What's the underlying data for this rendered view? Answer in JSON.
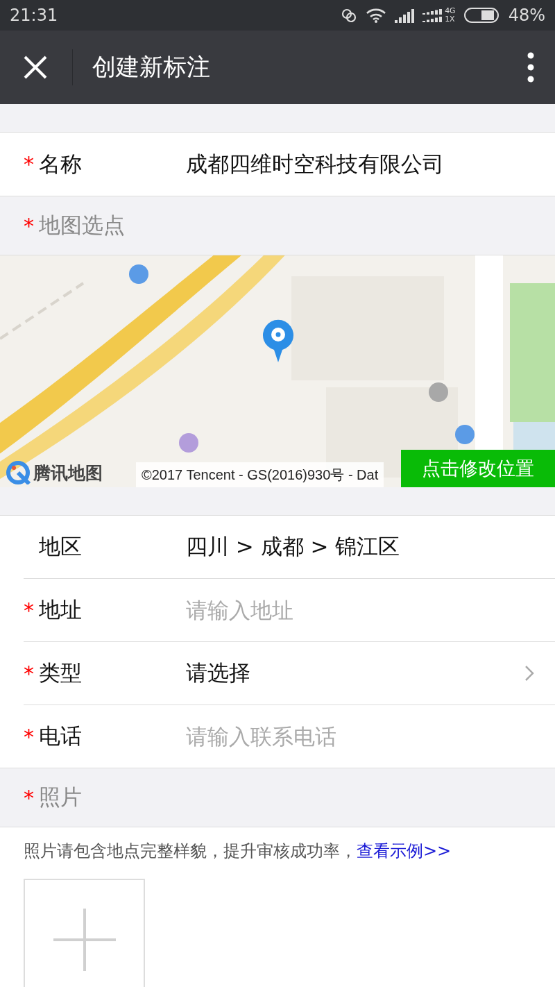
{
  "status_bar": {
    "time": "21:31",
    "network_top": "4G",
    "network_bottom": "1X",
    "battery": "48%"
  },
  "nav": {
    "title": "创建新标注"
  },
  "name_row": {
    "marker": "*",
    "label": "名称",
    "value": "成都四维时空科技有限公司"
  },
  "map_section": {
    "marker": "*",
    "label": "地图选点"
  },
  "map": {
    "logo": "腾讯地图",
    "copyright": "©2017 Tencent - GS(2016)930号 - Dat",
    "button": "点击修改位置"
  },
  "rows": [
    {
      "kind": "value",
      "label": "地区",
      "value": "四川 > 成都 > 锦江区"
    },
    {
      "kind": "input",
      "marker": "*",
      "label": "地址",
      "placeholder": "请输入地址"
    },
    {
      "kind": "select",
      "marker": "*",
      "label": "类型",
      "value": "请选择"
    },
    {
      "kind": "input",
      "marker": "*",
      "label": "电话",
      "placeholder": "请输入联系电话"
    }
  ],
  "photo_section": {
    "marker": "*",
    "label": "照片"
  },
  "photo_hint": {
    "text": "照片请包含地点完整样貌，提升审核成功率，",
    "link": "查看示例>>"
  }
}
